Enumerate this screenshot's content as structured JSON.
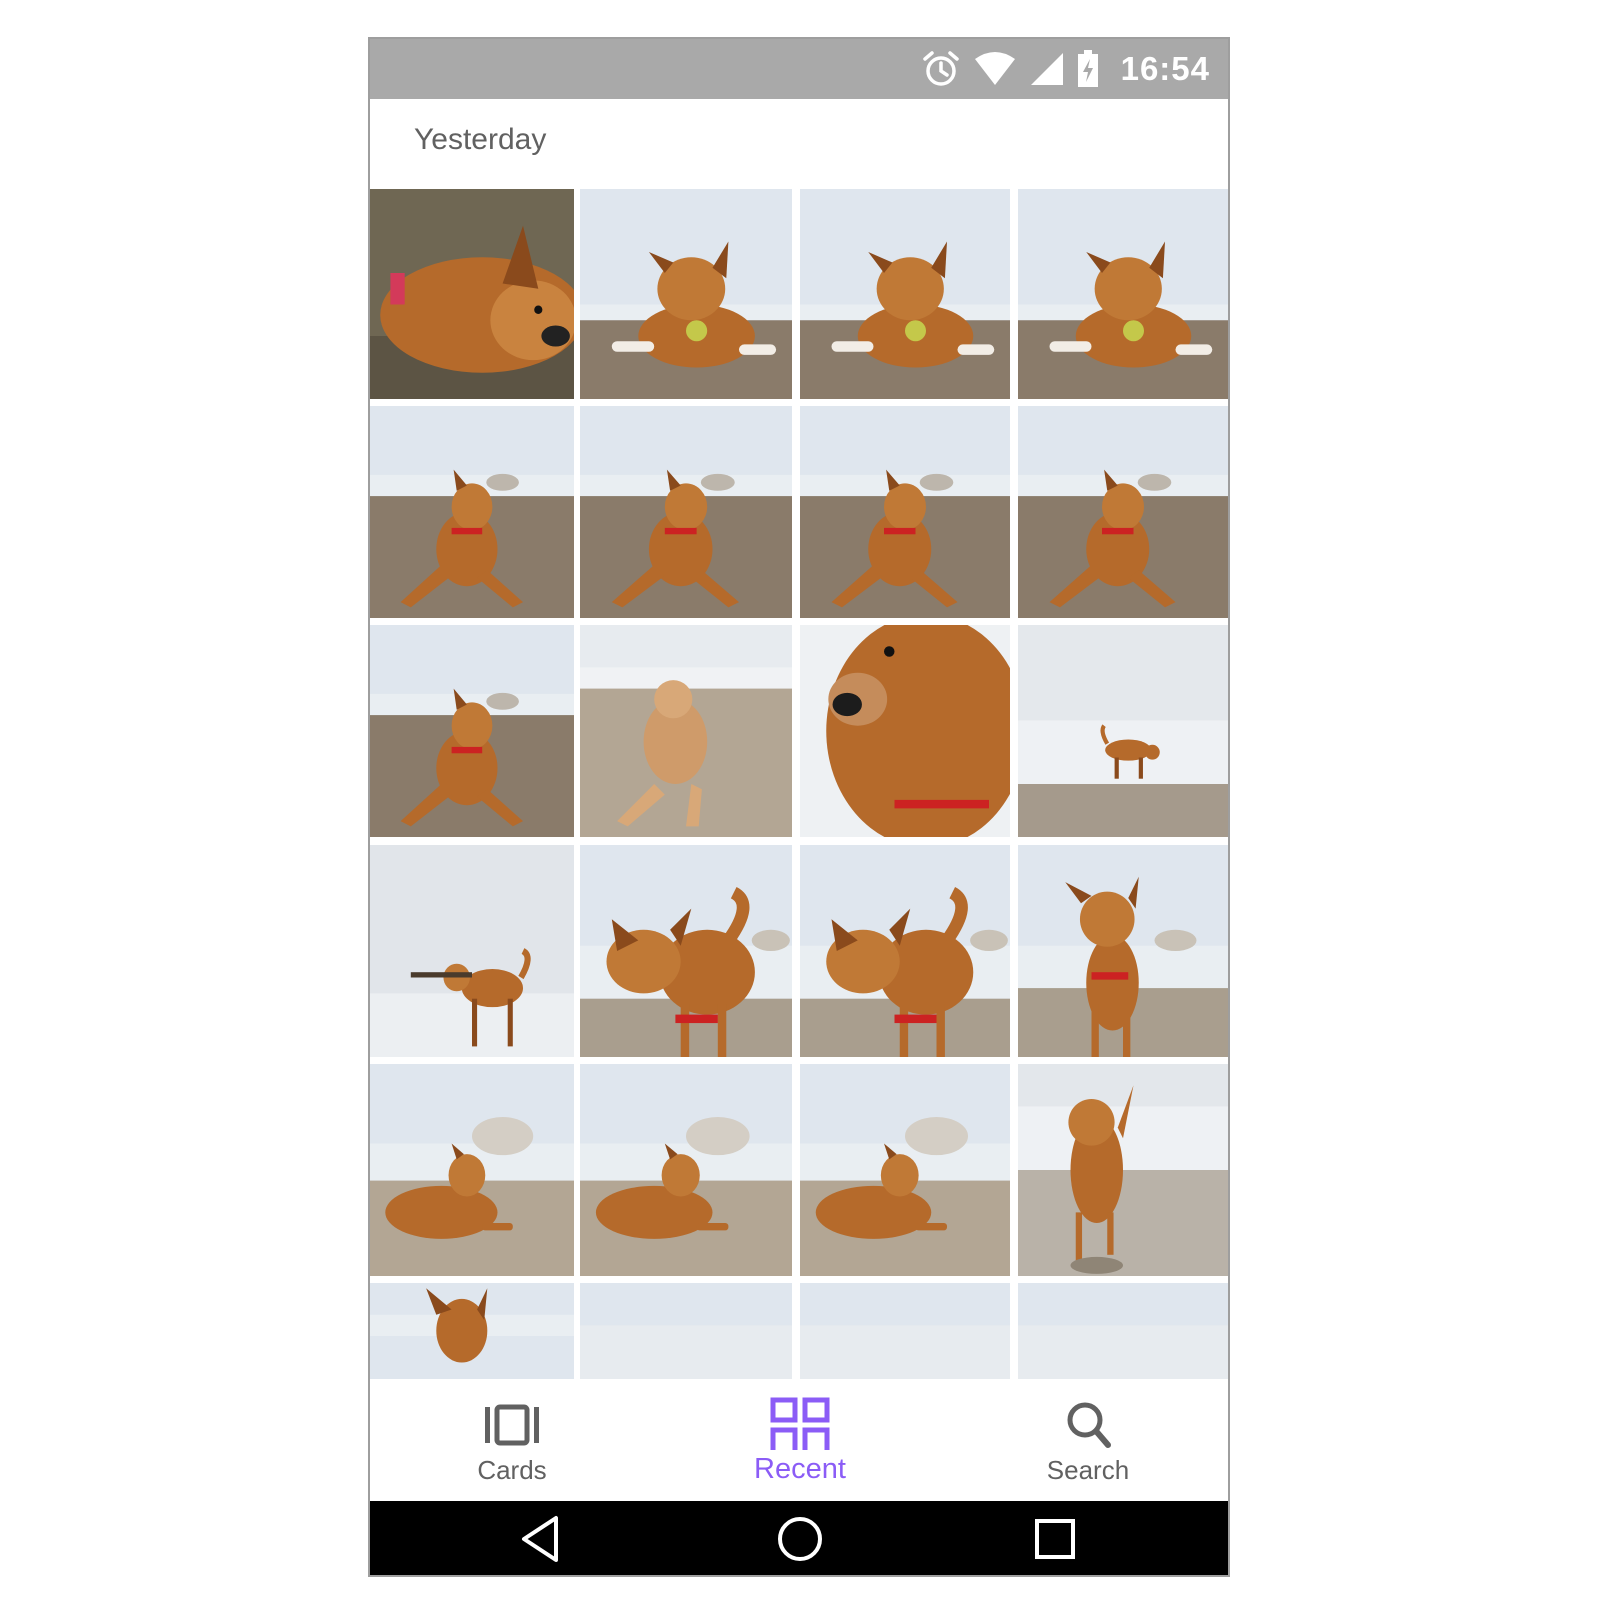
{
  "status_bar": {
    "time": "16:54",
    "icons": [
      "alarm-icon",
      "wifi-icon",
      "cell-signal-icon",
      "battery-charging-icon"
    ],
    "background": "#a9a9a9"
  },
  "section": {
    "title": "Yesterday"
  },
  "photos": [
    {
      "subject": "dog-closeup-lying"
    },
    {
      "subject": "dog-ball-beach"
    },
    {
      "subject": "dog-ball-beach"
    },
    {
      "subject": "dog-ball-beach"
    },
    {
      "subject": "dog-lying-beach"
    },
    {
      "subject": "dog-lying-beach"
    },
    {
      "subject": "dog-lying-beach"
    },
    {
      "subject": "dog-lying-beach"
    },
    {
      "subject": "dog-lying-beach"
    },
    {
      "subject": "dog-lying-beach-bright"
    },
    {
      "subject": "dog-face-closeup"
    },
    {
      "subject": "dog-wading-water"
    },
    {
      "subject": "dog-stick-standing"
    },
    {
      "subject": "dog-standing-mouth-open"
    },
    {
      "subject": "dog-standing-mouth-open"
    },
    {
      "subject": "dog-standing-facing"
    },
    {
      "subject": "dog-sitting-shore"
    },
    {
      "subject": "dog-sitting-shore"
    },
    {
      "subject": "dog-sitting-shore"
    },
    {
      "subject": "dog-running-wet-sand"
    },
    {
      "subject": "dog-partial"
    },
    {
      "subject": "beach-partial"
    },
    {
      "subject": "beach-partial"
    },
    {
      "subject": "beach-partial"
    }
  ],
  "bottom_nav": {
    "items": [
      {
        "label": "Cards",
        "icon": "cards-icon",
        "active": false
      },
      {
        "label": "Recent",
        "icon": "recent-grid-icon",
        "active": true
      },
      {
        "label": "Search",
        "icon": "search-icon",
        "active": false
      }
    ],
    "accent": "#8b5cf6",
    "inactive_color": "#616161"
  },
  "system_nav": {
    "buttons": [
      "back-icon",
      "home-icon",
      "recents-icon"
    ]
  }
}
